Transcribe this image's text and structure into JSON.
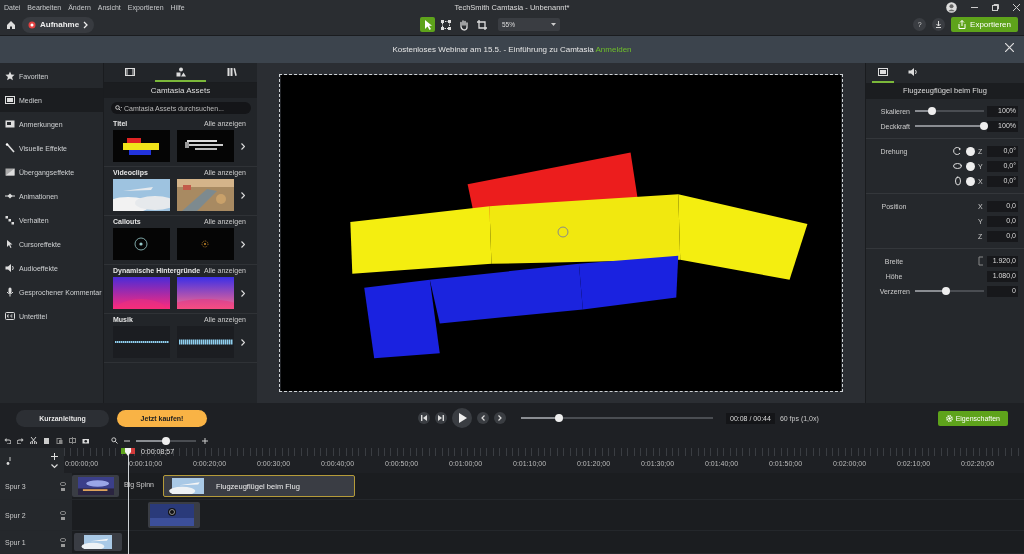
{
  "menu": [
    "Datei",
    "Bearbeiten",
    "Ändern",
    "Ansicht",
    "Exportieren",
    "Hilfe"
  ],
  "window": {
    "title": "TechSmith Camtasia - Unbenannt*"
  },
  "toolbar": {
    "record_label": "Aufnahme",
    "zoom": "55%",
    "help": "?",
    "export_label": "Exportieren",
    "tools": [
      {
        "kind": "select",
        "selected": true
      },
      {
        "kind": "transform",
        "selected": false
      },
      {
        "kind": "pan",
        "selected": false
      },
      {
        "kind": "crop",
        "selected": false
      }
    ]
  },
  "banner": {
    "text": "Kostenloses Webinar am 15.5. - Einführung zu Camtasia",
    "link": "Anmelden"
  },
  "sidebar": {
    "items": [
      {
        "label": "Favoriten",
        "kind": "star",
        "selected": false
      },
      {
        "label": "Medien",
        "kind": "film",
        "selected": true
      },
      {
        "label": "Anmerkungen",
        "kind": "note",
        "selected": false
      },
      {
        "label": "Visuelle Effekte",
        "kind": "wand",
        "selected": false
      },
      {
        "label": "Übergangseffekte",
        "kind": "transition",
        "selected": false
      },
      {
        "label": "Animationen",
        "kind": "animation",
        "selected": false
      },
      {
        "label": "Verhalten",
        "kind": "behavior",
        "selected": false
      },
      {
        "label": "Cursoreffekte",
        "kind": "cursor",
        "selected": false
      },
      {
        "label": "Audioeffekte",
        "kind": "speaker",
        "selected": false
      },
      {
        "label": "Gesprochener Kommentar",
        "kind": "mic",
        "selected": false
      },
      {
        "label": "Untertitel",
        "kind": "cc",
        "selected": false
      }
    ]
  },
  "assets": {
    "title": "Camtasia Assets",
    "search_placeholder": "Camtasia Assets durchsuchen...",
    "tabs": [
      {
        "kind": "media",
        "selected": false
      },
      {
        "kind": "assets",
        "selected": true
      },
      {
        "kind": "library",
        "selected": false
      }
    ],
    "sections": [
      {
        "title": "Titel",
        "link": "Alle anzeigen",
        "kind": "titles"
      },
      {
        "title": "Videoclips",
        "link": "Alle anzeigen",
        "kind": "video"
      },
      {
        "title": "Callouts",
        "link": "Alle anzeigen",
        "kind": "callouts"
      },
      {
        "title": "Dynamische Hintergründe",
        "link": "Alle anzeigen",
        "kind": "backgrounds"
      },
      {
        "title": "Musik",
        "link": "Alle anzeigen",
        "kind": "music"
      }
    ]
  },
  "properties": {
    "title": "Flugzeugflügel beim Flug",
    "tabs": [
      {
        "kind": "visual",
        "selected": true
      },
      {
        "kind": "audio",
        "selected": false
      }
    ],
    "sliders": [
      {
        "label": "Skalieren",
        "level": 0.25,
        "value": "100%"
      },
      {
        "label": "Deckkraft",
        "level": 1,
        "value": "100%"
      }
    ],
    "rotation_label": "Drehung",
    "rotation": [
      {
        "axis": "Z",
        "value": "0,0°"
      },
      {
        "axis": "Y",
        "value": "0,0°"
      },
      {
        "axis": "X",
        "value": "0,0°"
      }
    ],
    "position_label": "Position",
    "position": [
      {
        "axis": "X",
        "value": "0,0"
      },
      {
        "axis": "Y",
        "value": "0,0"
      },
      {
        "axis": "Z",
        "value": "0,0"
      }
    ],
    "size": [
      {
        "label": "Breite",
        "value": "1.920,0"
      },
      {
        "label": "Höhe",
        "value": "1.080,0"
      }
    ],
    "distort": {
      "label": "Verzerren",
      "level": 0.45,
      "value": "0"
    }
  },
  "playback": {
    "guide": "Kurzanleitung",
    "buy": "Jetzt kaufen!",
    "progress": {
      "level": 0.2
    },
    "time": "00:08 / 00:44",
    "fps": "60 fps (1,0x)",
    "properties": "Eigenschaften"
  },
  "timeline": {
    "zoom": {
      "level": 0.5
    },
    "playhead": "0:00:08;57",
    "ticks": [
      "0:00:00;00",
      "0:00:10;00",
      "0:00:20;00",
      "0:00:30;00",
      "0:00:40;00",
      "0:00:50;00",
      "0:01:00;00",
      "0:01:10;00",
      "0:01:20;00",
      "0:01:30;00",
      "0:01:40;00",
      "0:01:50;00",
      "0:02:00;00",
      "0:02:10;00",
      "0:02:20;00"
    ],
    "tracks": [
      {
        "name": "Spur 3",
        "clips": [
          {
            "kind": "city"
          },
          {
            "kind": "transition",
            "label": "Big Spinn"
          },
          {
            "kind": "sky",
            "label": "Flugzeugflügel beim Flug",
            "selected": true
          }
        ]
      },
      {
        "name": "Spur 2",
        "clips": [
          {
            "kind": "callout"
          }
        ]
      },
      {
        "name": "Spur 1",
        "clips": [
          {
            "kind": "sky"
          }
        ]
      }
    ]
  }
}
